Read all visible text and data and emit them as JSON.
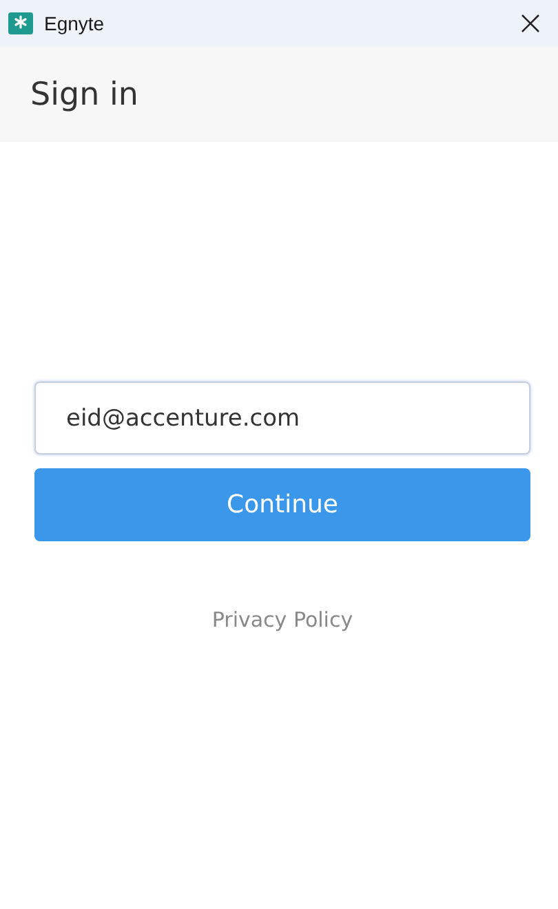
{
  "window": {
    "title": "Egnyte"
  },
  "header": {
    "title": "Sign in"
  },
  "form": {
    "email": {
      "value": "eid@accenture.com"
    },
    "submit": "Continue",
    "link": "Privacy Policy"
  }
}
